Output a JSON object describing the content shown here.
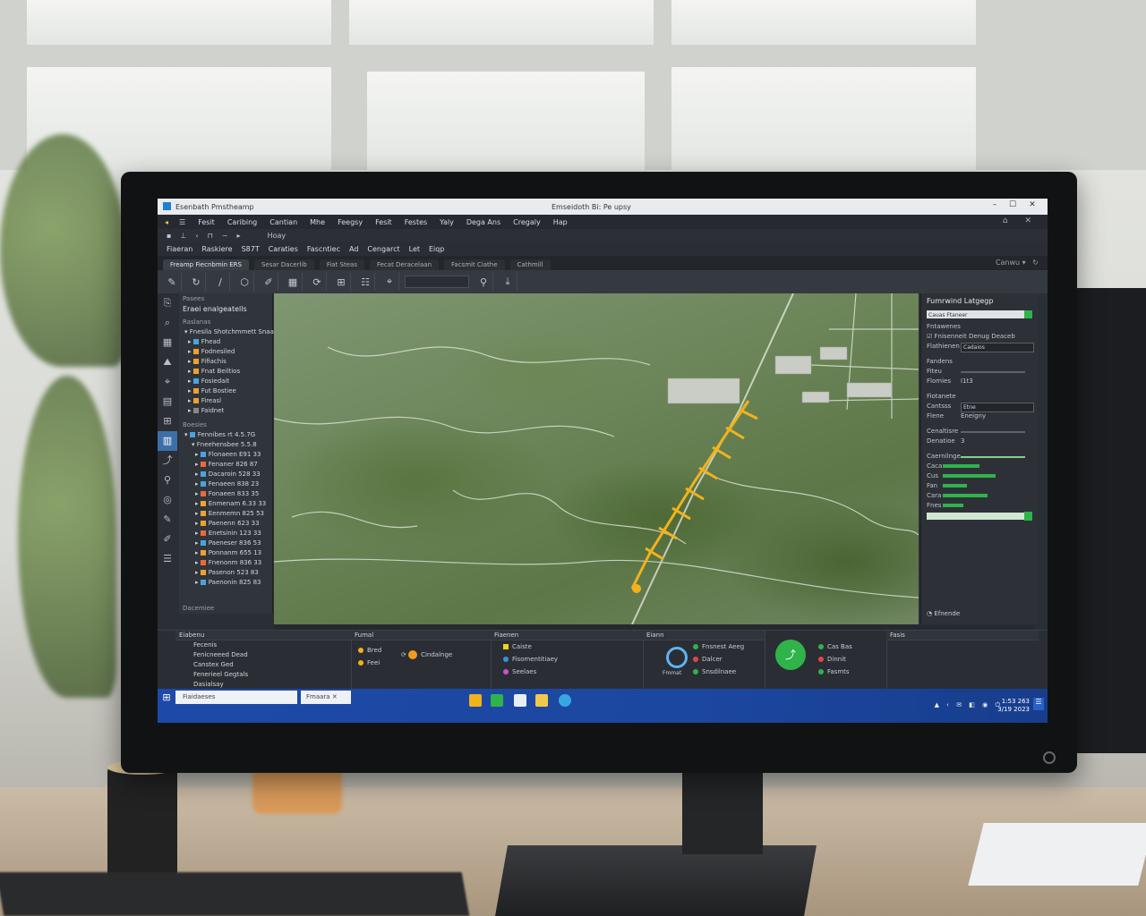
{
  "window": {
    "app_title": "Esenbath Pmstheamp",
    "doc_title": "Emseidoth Bi: Pe upsy"
  },
  "menu": {
    "items": [
      "Fesit",
      "Caribing",
      "Cantian",
      "Mhe",
      "Feegsy",
      "Fesit",
      "Festes",
      "Yaly",
      "Dega Ans",
      "Cregaly",
      "Hap"
    ]
  },
  "toolbar": {
    "items": [
      "Hoay"
    ]
  },
  "path": {
    "items": [
      "Fiaeran",
      "Raskiere",
      "S87T",
      "Caraties",
      "Fascntiec",
      "Ad",
      "Cengarct",
      "Let",
      "Eiqp"
    ]
  },
  "tabs": {
    "items": [
      "Freamp Fiecnbmin ERS",
      "Sesar Dacerlib",
      "Fiat Steas",
      "Fecat Deracelaan",
      "Facsmit Ciathe",
      "Cathmill"
    ],
    "right_label": "Canwu"
  },
  "layers": {
    "header": "Pasees",
    "title": "Eraei enalgeatells",
    "section1": "Raslanas",
    "section1_item": "Fnesila Shotchmmett Snaate",
    "tree_top": [
      {
        "label": "Fhead",
        "color": "#4aa3df"
      },
      {
        "label": "Fodnesiled",
        "color": "#f0a030"
      },
      {
        "label": "Fifiachis",
        "color": "#f0a030"
      },
      {
        "label": "Fnat Beiltios",
        "color": "#f0a030"
      },
      {
        "label": "Fosiedait",
        "color": "#4aa3df"
      },
      {
        "label": "Fut Bostiee",
        "color": "#f0a030"
      },
      {
        "label": "Fireasl",
        "color": "#f0a030"
      },
      {
        "label": "Faidnet",
        "color": "#888888"
      }
    ],
    "section2": "Boesies",
    "tree_root": "Fennibes rt 4.5.7G",
    "tree_sub": "Fneehensbee 5.5.8",
    "tree_bottom": [
      {
        "label": "Flonaeen E91 33",
        "color": "#4aa3df"
      },
      {
        "label": "Fenaner 826 87",
        "color": "#e86a3a"
      },
      {
        "label": "Dacaroin 528 33",
        "color": "#4aa3df"
      },
      {
        "label": "Fenaeen 838 23",
        "color": "#4aa3df"
      },
      {
        "label": "Fonaeen 833 35",
        "color": "#e86a3a"
      },
      {
        "label": "Enmenam 6.33 33",
        "color": "#f0a030"
      },
      {
        "label": "Eenmemn 825 53",
        "color": "#f0a030"
      },
      {
        "label": "Paenenn 623 33",
        "color": "#f0a030"
      },
      {
        "label": "Enetsinin 123 33",
        "color": "#e86a3a"
      },
      {
        "label": "Paeneser 836 53",
        "color": "#4aa3df"
      },
      {
        "label": "Ponnanm 655 13",
        "color": "#f0a030"
      },
      {
        "label": "Fnenonm 836 33",
        "color": "#e86a3a"
      },
      {
        "label": "Pasenon 523 83",
        "color": "#f0a030"
      },
      {
        "label": "Paenonin 825 83",
        "color": "#4aa3df"
      }
    ],
    "footer": "Dacemiee"
  },
  "props": {
    "title": "Fumrwind Latgegp",
    "search_value": "Cauas Ftaneer",
    "section1": "Fntawenes",
    "row1": "Fnisenneit Denug Deaceb",
    "row2_label": "Flathienen Fesmaiee",
    "row2_value": "Cadaios",
    "section2": "Fandens",
    "row3": "Fiteu",
    "row4_label": "Flomies",
    "row4_value": "I1t3",
    "section3": "Fiotanete",
    "row5_label": "Cantsss",
    "row5_value": "Etne",
    "row6_label": "Flene",
    "row6_value": "Eneigny",
    "section4": "Cenaltisre",
    "row7_label": "Denatioe",
    "row7_value": "3",
    "section5": "Caernilnge",
    "stats": [
      {
        "label": "Caca",
        "fill": 0.45
      },
      {
        "label": "Cus",
        "fill": 0.65
      },
      {
        "label": "Fan",
        "fill": 0.3
      },
      {
        "label": "Cara",
        "fill": 0.55
      },
      {
        "label": "Fnes",
        "fill": 0.25
      }
    ],
    "bottom": "Efnende"
  },
  "bottom_panel": {
    "col1_header": "Eiabenu",
    "col1_items": [
      "Fecenis",
      "Fenicneeed Dead",
      "Canstex Ged",
      "Fenerieel Gegtals",
      "Dasialsay"
    ],
    "col2_header": "Fumal",
    "col2_items": [
      "Bred",
      "Feei",
      "Cindalnge"
    ],
    "col3_header": "Fiaenen",
    "col3_items": [
      "Caiste",
      "Fisomentitiaey",
      "Seelaes"
    ],
    "col4_header": "Eiann",
    "col4_items": [
      "Fnsnest Aeeg",
      "Dalcer",
      "Snsdilnaee",
      "Fmmat"
    ],
    "col5_items": [
      "Cas Bas",
      "Dinnit",
      "Fasmts"
    ],
    "col6_header": "Fasis"
  },
  "taskbar": {
    "search_text": "Fiaidaeses",
    "app_label": "Fmaara",
    "clock_time": "1:53 263",
    "clock_date": "3/19 2023"
  },
  "colors": {
    "accent": "#2fb34a",
    "taskbar": "#1d4aa8",
    "selection": "#3c6fa8",
    "route": "#f2b21c"
  }
}
